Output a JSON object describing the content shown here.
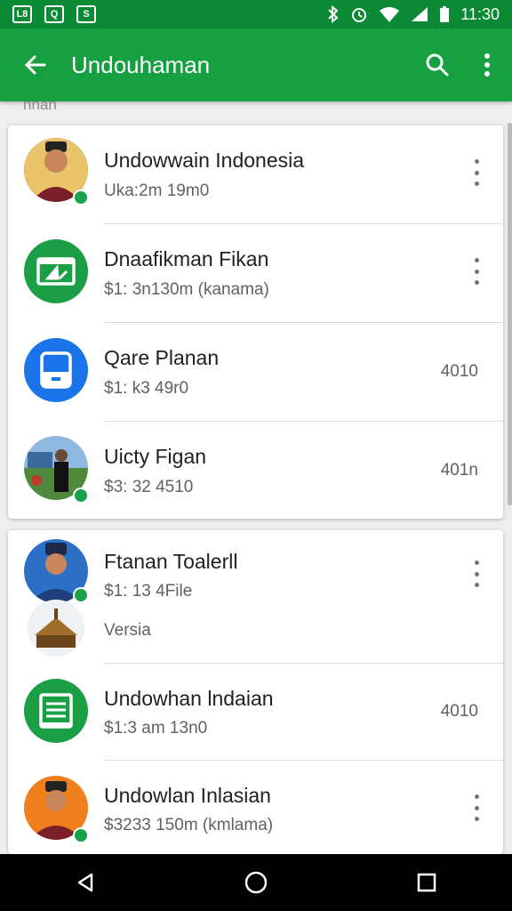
{
  "status_bar": {
    "time": "11:30",
    "left_icons": [
      "L8",
      "Q",
      "S"
    ],
    "right_icons": [
      "bluetooth-icon",
      "alarm-icon",
      "wifi-icon",
      "signal-icon",
      "battery-icon"
    ]
  },
  "app_bar": {
    "title": "Undouhaman",
    "actions": [
      "search-icon",
      "more-vert-icon"
    ]
  },
  "section_label": "nnan",
  "card1": [
    {
      "title": "Undowwain Indonesia",
      "subtitle": "Uka:2m 19m0",
      "value": "",
      "menu": true,
      "avatar": "person-photo",
      "badge": true
    },
    {
      "title": "Dnaafikman Fikan",
      "subtitle": "$1: 3n130m (kanama)",
      "value": "",
      "menu": true,
      "avatar": "green-card-icon",
      "badge": false
    },
    {
      "title": "Qare Planan",
      "subtitle": "$1: k3 49r0",
      "value": "4010",
      "menu": false,
      "avatar": "blue-device-icon",
      "badge": false
    },
    {
      "title": "Uicty Figan",
      "subtitle": "$3: 32 4510",
      "value": "401n",
      "menu": false,
      "avatar": "person-landscape-photo",
      "badge": true
    }
  ],
  "card2": [
    {
      "title": "Ftanan Toalerll",
      "subtitle": "$1: 13 4File",
      "subtitle2": "Versia",
      "value": "",
      "menu": true,
      "avatar": "person-photo-blue",
      "badge": true
    },
    {
      "title": "Undowhan lndaian",
      "subtitle": "$1:3 am 13n0",
      "value": "4010",
      "menu": false,
      "avatar": "green-document-icon",
      "badge": false
    },
    {
      "title": "Undowlan Inlasian",
      "subtitle": "$3233 150m (kmlama)",
      "value": "",
      "menu": true,
      "avatar": "person-photo-orange",
      "badge": true
    }
  ],
  "colors": {
    "status_bar": "#0b8a35",
    "app_bar": "#16a041",
    "accent_green": "#19a24a",
    "accent_blue": "#1a73e8"
  }
}
